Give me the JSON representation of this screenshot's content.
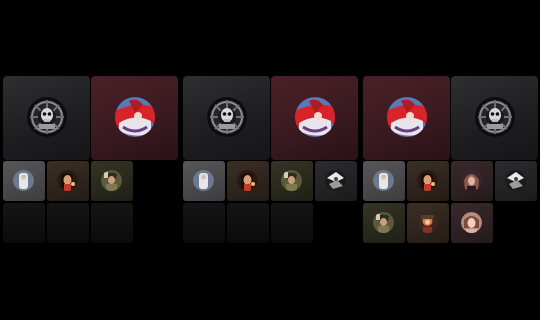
{
  "screen": {
    "background": "#000000"
  },
  "panels": [
    {
      "name": "call-panel-1",
      "primary_avatars": [
        "skull-wheel-avatar",
        "red-figure-avatar"
      ]
    },
    {
      "name": "call-panel-2",
      "primary_avatars": [
        "skull-wheel-avatar",
        "red-figure-avatar"
      ]
    },
    {
      "name": "call-panel-3",
      "primary_avatars": [
        "red-figure-avatar",
        "skull-wheel-avatar"
      ]
    }
  ],
  "colors": {
    "red_tile": "#3a1a20",
    "dark_tile": "#1e1e21",
    "gray_tile": "#4a4a4c",
    "avatar_red": "#d8232a"
  }
}
